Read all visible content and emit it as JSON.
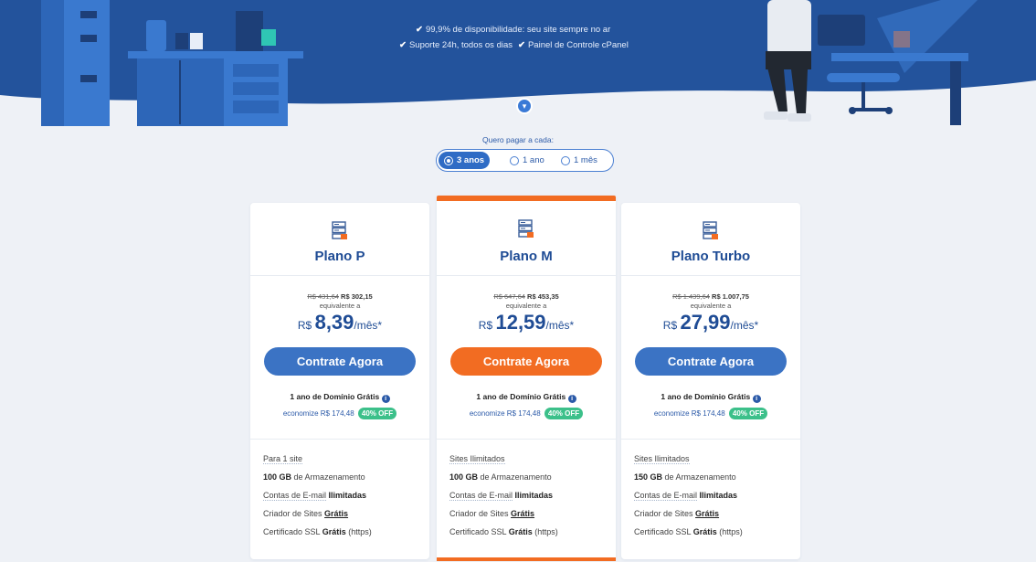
{
  "colors": {
    "hero_bg": "#23539c",
    "accent_orange": "#f26c22",
    "primary_blue": "#3b73c4",
    "badge_green": "#3cc08a"
  },
  "hero": {
    "features_line1": "99,9% de disponibilidade: seu site sempre no ar",
    "features_line2a": "Suporte 24h, todos os dias",
    "features_line2b": "Painel de Controle cPanel",
    "check_icon": "✔",
    "scroll_icon": "chevron-down-icon"
  },
  "billing": {
    "label": "Quero pagar a cada:",
    "options": [
      {
        "label": "3 anos",
        "selected": true
      },
      {
        "label": "1 ano",
        "selected": false
      },
      {
        "label": "1 mês",
        "selected": false
      }
    ]
  },
  "plans": [
    {
      "name": "Plano P",
      "old_price": "R$ 431,64",
      "new_price": "R$ 302,15",
      "equivalent": "equivalente a",
      "currency": "R$",
      "monthly": "8,39",
      "per": "/mês*",
      "cta": "Contrate Agora",
      "domain": "1 ano de Domínio Grátis",
      "save": "economize R$ 174,48",
      "badge": "40% OFF",
      "features": {
        "sites": "Para 1 site",
        "storage_bold": "100 GB",
        "storage_rest": "de Armazenamento",
        "email_pre": "Contas de E-mail",
        "email_bold": "Ilimitadas",
        "builder_pre": "Criador de Sites",
        "builder_bold": "Grátis",
        "ssl_pre": "Certificado SSL",
        "ssl_bold": "Grátis",
        "ssl_post": "(https)"
      }
    },
    {
      "name": "Plano M",
      "old_price": "R$ 647,64",
      "new_price": "R$ 453,35",
      "equivalent": "equivalente a",
      "currency": "R$",
      "monthly": "12,59",
      "per": "/mês*",
      "cta": "Contrate Agora",
      "domain": "1 ano de Domínio Grátis",
      "save": "economize R$ 174,48",
      "badge": "40% OFF",
      "features": {
        "sites": "Sites Ilimitados",
        "storage_bold": "100 GB",
        "storage_rest": "de Armazenamento",
        "email_pre": "Contas de E-mail",
        "email_bold": "Ilimitadas",
        "builder_pre": "Criador de Sites",
        "builder_bold": "Grátis",
        "ssl_pre": "Certificado SSL",
        "ssl_bold": "Grátis",
        "ssl_post": "(https)"
      }
    },
    {
      "name": "Plano Turbo",
      "old_price": "R$ 1.439,64",
      "new_price": "R$ 1.007,75",
      "equivalent": "equivalente a",
      "currency": "R$",
      "monthly": "27,99",
      "per": "/mês*",
      "cta": "Contrate Agora",
      "domain": "1 ano de Domínio Grátis",
      "save": "economize R$ 174,48",
      "badge": "40% OFF",
      "features": {
        "sites": "Sites Ilimitados",
        "storage_bold": "150 GB",
        "storage_rest": "de Armazenamento",
        "email_pre": "Contas de E-mail",
        "email_bold": "Ilimitadas",
        "builder_pre": "Criador de Sites",
        "builder_bold": "Grátis",
        "ssl_pre": "Certificado SSL",
        "ssl_bold": "Grátis",
        "ssl_post": "(https)"
      }
    }
  ]
}
